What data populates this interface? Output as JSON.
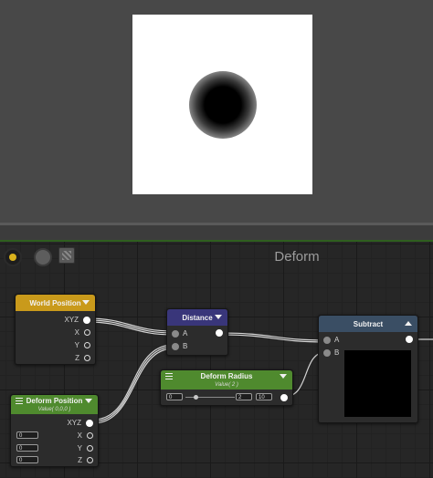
{
  "graph": {
    "title": "Deform"
  },
  "nodes": {
    "world_position": {
      "title": "World Position",
      "header_color": "#c99a1b",
      "output": "XYZ",
      "outputs": [
        "X",
        "Y",
        "Z"
      ]
    },
    "distance": {
      "title": "Distance",
      "header_color": "#39367a",
      "inputs": [
        "A",
        "B"
      ]
    },
    "deform_radius": {
      "title": "Deform Radius",
      "subtitle": "Value( 2 )",
      "header_color": "#4f8a2e",
      "min": "0",
      "value": "2",
      "max": "10"
    },
    "deform_position": {
      "title": "Deform Position",
      "subtitle": "Value( 0,0,0 )",
      "header_color": "#4f8a2e",
      "output": "XYZ",
      "outputs": [
        "X",
        "Y",
        "Z"
      ],
      "fields": [
        "0",
        "0",
        "0"
      ]
    },
    "subtract": {
      "title": "Subtract",
      "header_color": "#3a4e64",
      "inputs": [
        "A",
        "B"
      ]
    }
  },
  "colors": {
    "port_active": "#ffffff",
    "wire": "#d4d4d4",
    "grid": "#262626"
  },
  "icons": [
    "shader-preview-icon",
    "material-ball-icon",
    "texture-icon"
  ]
}
